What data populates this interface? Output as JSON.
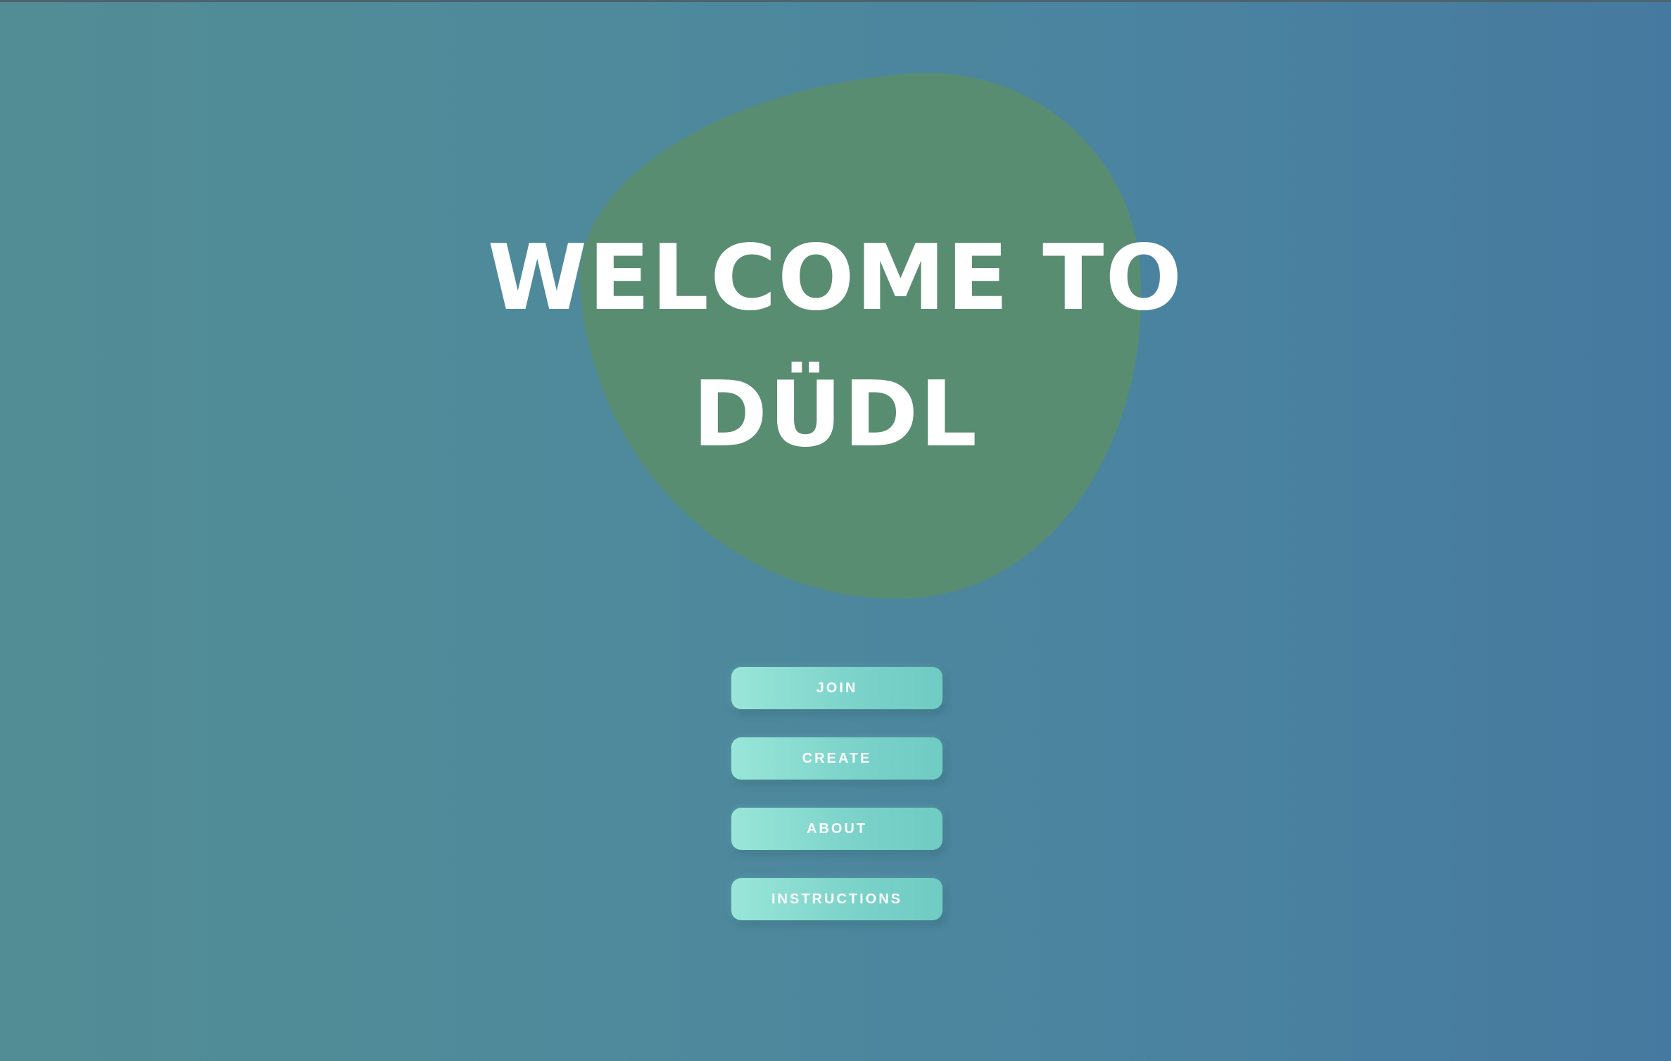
{
  "hero": {
    "title_line1": "WELCOME TO",
    "title_line2": "DÜDL"
  },
  "menu": {
    "buttons": [
      {
        "label": "JOIN"
      },
      {
        "label": "CREATE"
      },
      {
        "label": "ABOUT"
      },
      {
        "label": "INSTRUCTIONS"
      }
    ]
  },
  "colors": {
    "background_left": "#528d95",
    "background_right": "#46799f",
    "blob": "#598d72",
    "button": "#7ad2c9",
    "title_text": "#ffffff"
  }
}
